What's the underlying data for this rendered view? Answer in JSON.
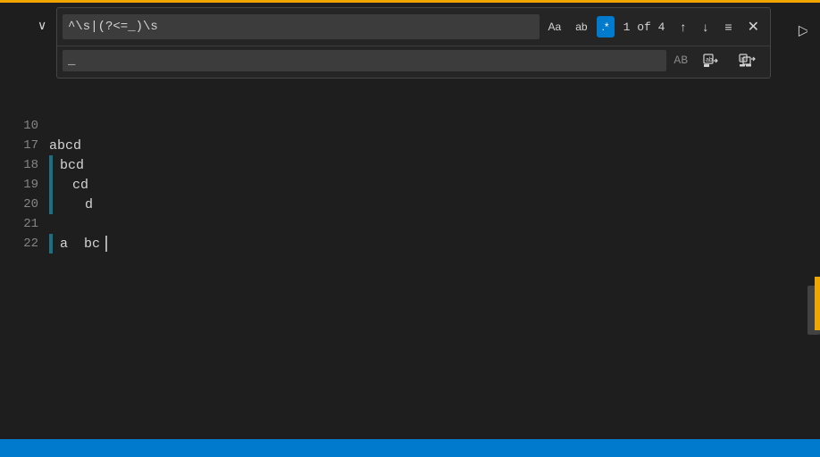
{
  "topAccent": true,
  "findWidget": {
    "searchValue": "^\\s|(?<=_)\\s",
    "replaceValue": "_",
    "replacePlaceholder": "_",
    "optionAa_label": "Aa",
    "optionAb_label": "ab",
    "optionRegex_label": ".*",
    "count_label": "1 of 4",
    "navUp_label": "↑",
    "navDown_label": "↓",
    "menu_label": "≡",
    "close_label": "✕",
    "replaceAB_label": "AB",
    "replaceOne_icon": "replace-one",
    "replaceAll_icon": "replace-all"
  },
  "chevron": {
    "label": "∨"
  },
  "activityBar": {
    "runIcon": "▷"
  },
  "editor": {
    "lines": [
      {
        "number": "10",
        "indent": 0,
        "text": "",
        "hasBar": false
      },
      {
        "number": "17",
        "indent": 0,
        "text": "abcd",
        "hasBar": false
      },
      {
        "number": "18",
        "indent": 1,
        "text": "bcd",
        "hasBar": true
      },
      {
        "number": "19",
        "indent": 2,
        "text": "cd",
        "hasBar": true
      },
      {
        "number": "20",
        "indent": 3,
        "text": "d",
        "hasBar": true
      },
      {
        "number": "21",
        "indent": 0,
        "text": "",
        "hasBar": false
      },
      {
        "number": "22",
        "indent": 1,
        "text": "a  bc",
        "hasBar": true
      }
    ],
    "cursorLine": 22
  },
  "bottomBar": {}
}
